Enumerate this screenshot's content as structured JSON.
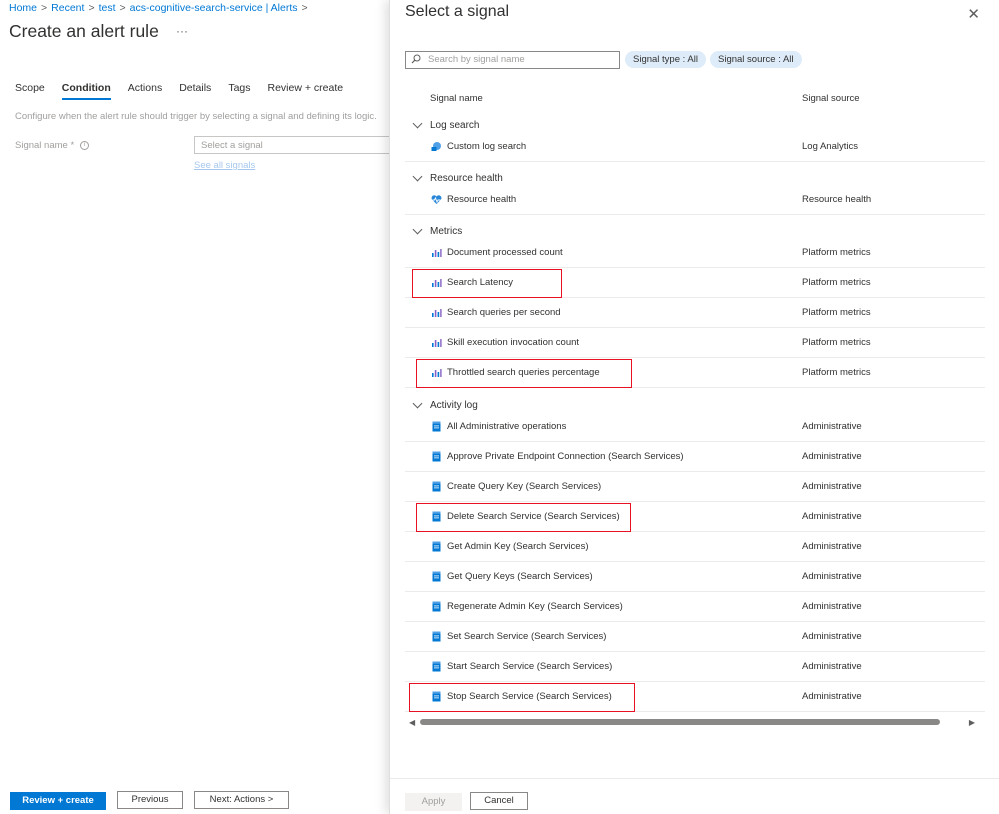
{
  "breadcrumb": [
    "Home",
    "Recent",
    "test",
    "acs-cognitive-search-service | Alerts"
  ],
  "page_title": "Create an alert rule",
  "more": "···",
  "tabs": [
    "Scope",
    "Condition",
    "Actions",
    "Details",
    "Tags",
    "Review + create"
  ],
  "active_tab": "Condition",
  "description": "Configure when the alert rule should trigger by selecting a signal and defining its logic.",
  "signal_field": {
    "label": "Signal name *",
    "placeholder": "Select a signal",
    "see_all": "See all signals"
  },
  "left_footer": {
    "review": "Review + create",
    "previous": "Previous",
    "next": "Next: Actions >"
  },
  "panel": {
    "title": "Select a signal",
    "search_placeholder": "Search by signal name",
    "filter_type": "Signal type : All",
    "filter_source": "Signal source : All",
    "col_name": "Signal name",
    "col_source": "Signal source",
    "groups": [
      {
        "label": "Log search",
        "rows": [
          {
            "name": "Custom log search",
            "source": "Log Analytics",
            "icon": "log-search-icon"
          }
        ]
      },
      {
        "label": "Resource health",
        "rows": [
          {
            "name": "Resource health",
            "source": "Resource health",
            "icon": "heart-icon"
          }
        ]
      },
      {
        "label": "Metrics",
        "rows": [
          {
            "name": "Document processed count",
            "source": "Platform metrics",
            "icon": "metric-icon"
          },
          {
            "name": "Search Latency",
            "source": "Platform metrics",
            "icon": "metric-icon"
          },
          {
            "name": "Search queries per second",
            "source": "Platform metrics",
            "icon": "metric-icon"
          },
          {
            "name": "Skill execution invocation count",
            "source": "Platform metrics",
            "icon": "metric-icon"
          },
          {
            "name": "Throttled search queries percentage",
            "source": "Platform metrics",
            "icon": "metric-icon"
          }
        ]
      },
      {
        "label": "Activity log",
        "rows": [
          {
            "name": "All Administrative operations",
            "source": "Administrative",
            "icon": "activity-log-icon"
          },
          {
            "name": "Approve Private Endpoint Connection (Search Services)",
            "source": "Administrative",
            "icon": "activity-log-icon"
          },
          {
            "name": "Create Query Key (Search Services)",
            "source": "Administrative",
            "icon": "activity-log-icon"
          },
          {
            "name": "Delete Search Service (Search Services)",
            "source": "Administrative",
            "icon": "activity-log-icon"
          },
          {
            "name": "Get Admin Key (Search Services)",
            "source": "Administrative",
            "icon": "activity-log-icon"
          },
          {
            "name": "Get Query Keys (Search Services)",
            "source": "Administrative",
            "icon": "activity-log-icon"
          },
          {
            "name": "Regenerate Admin Key (Search Services)",
            "source": "Administrative",
            "icon": "activity-log-icon"
          },
          {
            "name": "Set Search Service (Search Services)",
            "source": "Administrative",
            "icon": "activity-log-icon"
          },
          {
            "name": "Start Search Service (Search Services)",
            "source": "Administrative",
            "icon": "activity-log-icon"
          },
          {
            "name": "Stop Search Service (Search Services)",
            "source": "Administrative",
            "icon": "activity-log-icon"
          }
        ]
      }
    ],
    "highlighted": [
      "Search Latency",
      "Throttled search queries percentage",
      "Delete Search Service (Search Services)",
      "Stop Search Service (Search Services)"
    ],
    "apply": "Apply",
    "cancel": "Cancel"
  },
  "colors": {
    "accent": "#0078d4",
    "highlight": "#e81123",
    "pill": "#deecf9"
  }
}
